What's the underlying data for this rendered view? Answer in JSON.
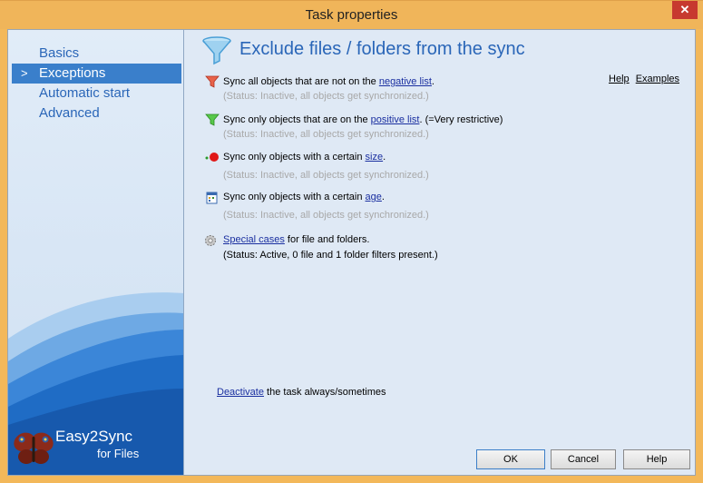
{
  "window": {
    "title": "Task properties",
    "close_label": "✕"
  },
  "sidebar": {
    "items": [
      {
        "label": "Basics",
        "active": false
      },
      {
        "label": "Exceptions",
        "active": true
      },
      {
        "label": "Automatic start",
        "active": false
      },
      {
        "label": "Advanced",
        "active": false
      }
    ],
    "active_marker": ">",
    "logo_name": "Easy2Sync",
    "logo_sub": "for Files"
  },
  "main": {
    "title": "Exclude files / folders from the sync",
    "help_link": "Help",
    "examples_link": "Examples",
    "rules": [
      {
        "pre": "Sync all objects that are not on the ",
        "link": "negative list",
        "post": ".",
        "status": "(Status: Inactive, all objects get synchronized.)",
        "icon": "red-funnel-icon"
      },
      {
        "pre": "Sync only objects that are on the ",
        "link": "positive list",
        "post": ". (=Very restrictive)",
        "status": "(Status: Inactive, all objects get synchronized.)",
        "icon": "green-funnel-icon"
      },
      {
        "pre": "Sync only objects with a certain ",
        "link": "size",
        "post": ".",
        "status": "(Status: Inactive, all objects get synchronized.)",
        "icon": "size-dots-icon"
      },
      {
        "pre": "Sync only objects with a certain ",
        "link": "age",
        "post": ".",
        "status": "(Status: Inactive, all objects get synchronized.)",
        "icon": "calendar-icon"
      },
      {
        "pre": "",
        "link": "Special cases",
        "post": " for file and folders.",
        "status": "(Status: Active, 0 file and 1 folder filters present.)",
        "icon": "gear-icon"
      }
    ],
    "deactivate_link": "Deactivate",
    "deactivate_text": " the task always/sometimes"
  },
  "buttons": {
    "ok": "OK",
    "cancel": "Cancel",
    "help": "Help"
  },
  "colors": {
    "accent": "#2a66b8",
    "titlebar": "#f0b55a",
    "close": "#c7392f",
    "link": "#1a2fa0"
  }
}
